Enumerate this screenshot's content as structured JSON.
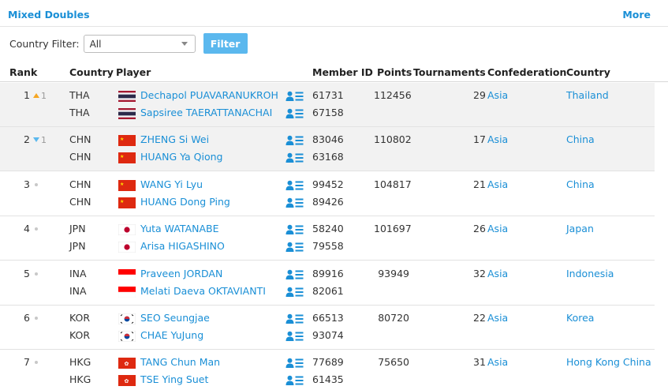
{
  "header": {
    "title": "Mixed Doubles",
    "more_label": "More"
  },
  "filter": {
    "label": "Country Filter:",
    "selected": "All",
    "button_label": "Filter"
  },
  "columns": {
    "rank": "Rank",
    "country": "Country",
    "player": "Player",
    "member_id": "Member ID",
    "points": "Points",
    "tournaments": "Tournaments",
    "confederation": "Confederation",
    "country_name": "Country"
  },
  "icons": {
    "rank_up": "triangle-up-icon",
    "rank_down": "triangle-down-icon",
    "rank_same": "dot-icon",
    "profile": "player-profile-icon"
  },
  "colors": {
    "accent": "#1a8fd6",
    "filter_button": "#5bb8ee",
    "rank_up": "#f5a623",
    "rank_down": "#5bb8ee",
    "row_shade": "#f2f2f2"
  },
  "rankings": [
    {
      "rank": "1",
      "change": "up",
      "change_value": "1",
      "points": "112456",
      "tournaments": "29",
      "confederation": "Asia",
      "country_name": "Thailand",
      "players": [
        {
          "code": "THA",
          "flag": "thailand-flag-icon",
          "name": "Dechapol PUAVARANUKROH",
          "member_id": "61731"
        },
        {
          "code": "THA",
          "flag": "thailand-flag-icon",
          "name": "Sapsiree TAERATTANACHAI",
          "member_id": "67158"
        }
      ]
    },
    {
      "rank": "2",
      "change": "down",
      "change_value": "1",
      "points": "110802",
      "tournaments": "17",
      "confederation": "Asia",
      "country_name": "China",
      "players": [
        {
          "code": "CHN",
          "flag": "china-flag-icon",
          "name": "ZHENG Si Wei",
          "member_id": "83046"
        },
        {
          "code": "CHN",
          "flag": "china-flag-icon",
          "name": "HUANG Ya Qiong",
          "member_id": "63168"
        }
      ]
    },
    {
      "rank": "3",
      "change": "same",
      "change_value": "",
      "points": "104817",
      "tournaments": "21",
      "confederation": "Asia",
      "country_name": "China",
      "players": [
        {
          "code": "CHN",
          "flag": "china-flag-icon",
          "name": "WANG Yi Lyu",
          "member_id": "99452"
        },
        {
          "code": "CHN",
          "flag": "china-flag-icon",
          "name": "HUANG Dong Ping",
          "member_id": "89426"
        }
      ]
    },
    {
      "rank": "4",
      "change": "same",
      "change_value": "",
      "points": "101697",
      "tournaments": "26",
      "confederation": "Asia",
      "country_name": "Japan",
      "players": [
        {
          "code": "JPN",
          "flag": "japan-flag-icon",
          "name": "Yuta WATANABE",
          "member_id": "58240"
        },
        {
          "code": "JPN",
          "flag": "japan-flag-icon",
          "name": "Arisa HIGASHINO",
          "member_id": "79558"
        }
      ]
    },
    {
      "rank": "5",
      "change": "same",
      "change_value": "",
      "points": "93949",
      "tournaments": "32",
      "confederation": "Asia",
      "country_name": "Indonesia",
      "players": [
        {
          "code": "INA",
          "flag": "indonesia-flag-icon",
          "name": "Praveen JORDAN",
          "member_id": "89916"
        },
        {
          "code": "INA",
          "flag": "indonesia-flag-icon",
          "name": "Melati Daeva OKTAVIANTI",
          "member_id": "82061"
        }
      ]
    },
    {
      "rank": "6",
      "change": "same",
      "change_value": "",
      "points": "80720",
      "tournaments": "22",
      "confederation": "Asia",
      "country_name": "Korea",
      "players": [
        {
          "code": "KOR",
          "flag": "korea-flag-icon",
          "name": "SEO Seungjae",
          "member_id": "66513"
        },
        {
          "code": "KOR",
          "flag": "korea-flag-icon",
          "name": "CHAE YuJung",
          "member_id": "93074"
        }
      ]
    },
    {
      "rank": "7",
      "change": "same",
      "change_value": "",
      "points": "75650",
      "tournaments": "31",
      "confederation": "Asia",
      "country_name": "Hong Kong China",
      "players": [
        {
          "code": "HKG",
          "flag": "hong-kong-flag-icon",
          "name": "TANG Chun Man",
          "member_id": "77689"
        },
        {
          "code": "HKG",
          "flag": "hong-kong-flag-icon",
          "name": "TSE Ying Suet",
          "member_id": "61435"
        }
      ]
    }
  ]
}
